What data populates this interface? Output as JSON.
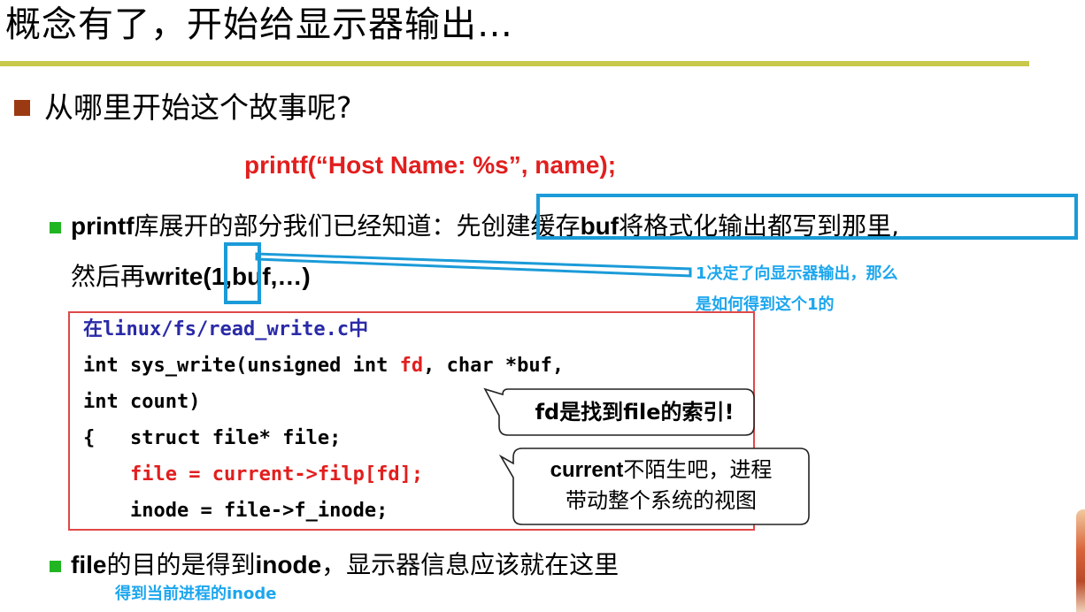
{
  "slide": {
    "title": "概念有了，开始给显示器输出…",
    "main_question": "从哪里开始这个故事呢?",
    "printf_call": "printf(“Host Name: %s”, name);",
    "para1": {
      "lead_bold": "printf",
      "lead_text": "库展开的部分我们已经知道：",
      "boxed_a": "先创建缓存",
      "boxed_bold": "buf",
      "boxed_b": "将格式化输出都写到那里,"
    },
    "para2": {
      "prefix": "然后再",
      "write_bold": "write(",
      "one": "1",
      "rest_bold": ",buf,…)"
    },
    "note1_line1": "1决定了向显示器输出，那么",
    "note1_line2": "是如何得到这个1的",
    "code": {
      "file_prefix": "在",
      "file_path": "linux/fs/read_write.c",
      "file_suffix": "中",
      "l1_a": "int sys_write(unsigned int ",
      "l1_fd": "fd",
      "l1_b": ", char *buf,",
      "l2": "int count)",
      "l3": "{   struct file* file;",
      "l4": "    file = current->filp[fd];",
      "l5": "    inode = file->f_inode;"
    },
    "callout1": {
      "a": "fd",
      "b": "是找到",
      "c": "file",
      "d": "的索引!"
    },
    "callout2": {
      "bold": "current",
      "line1_rest": "不陌生吧，进程",
      "line2": "带动整个系统的视图"
    },
    "para3": {
      "bold_a": "file",
      "text_a": "的目的是得到",
      "bold_b": "inode",
      "text_b": "，显示器信息应该就在这里"
    },
    "note2": "得到当前进程的inode"
  },
  "colors": {
    "title_rule": "#c8c84a",
    "bullet": "#9b3a12",
    "sub_bullet": "#21b621",
    "highlight_red": "#e21e1e",
    "annotation_blue": "#1b9bd8",
    "note_blue": "#1ca6ee",
    "code_border": "#e04848",
    "code_path": "#2a2aa8"
  }
}
